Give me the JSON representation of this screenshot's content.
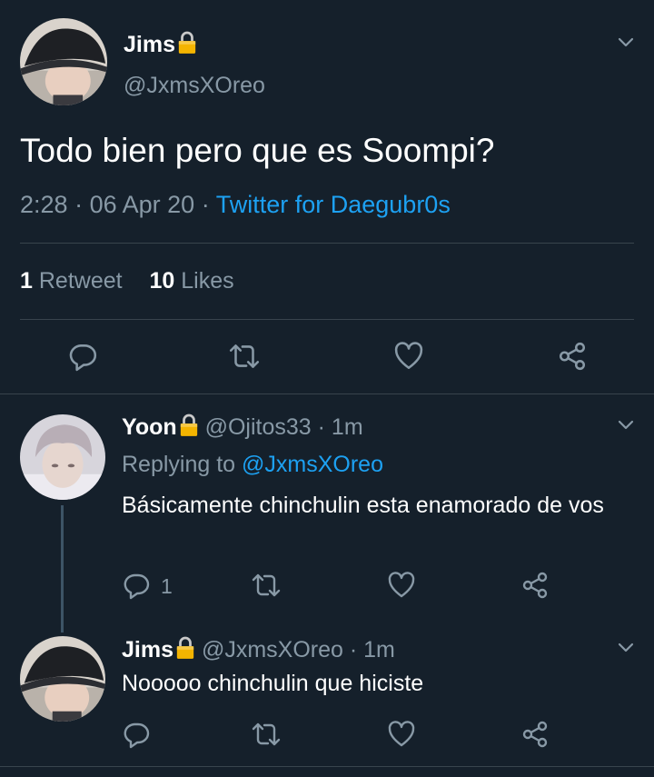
{
  "main_tweet": {
    "display_name": "Jims",
    "handle": "@JxmsXOreo",
    "text": "Todo bien pero que es Soompi?",
    "time": "2:28",
    "date": "06 Apr 20",
    "client": "Twitter for Daegubr0s",
    "retweet_count": "1",
    "retweet_label": "Retweet",
    "like_count": "10",
    "like_label": "Likes"
  },
  "replies": [
    {
      "display_name": "Yoon",
      "handle": "@Ojitos33",
      "age": "1m",
      "replying_label": "Replying to",
      "replying_to": "@JxmsXOreo",
      "text": "Básicamente chinchulin esta enamorado de vos",
      "reply_count": "1"
    },
    {
      "display_name": "Jims",
      "handle": "@JxmsXOreo",
      "age": "1m",
      "text": "Nooooo chinchulin que hiciste",
      "reply_count": ""
    }
  ],
  "separator": "·",
  "icons": {
    "protected": "lock-icon",
    "menu": "chevron-down-icon",
    "reply": "reply-icon",
    "retweet": "retweet-icon",
    "like": "heart-icon",
    "share": "share-icon"
  },
  "colors": {
    "background": "#15202b",
    "text": "#ffffff",
    "muted": "#8899a6",
    "accent": "#1da1f2",
    "divider": "#38444d"
  }
}
